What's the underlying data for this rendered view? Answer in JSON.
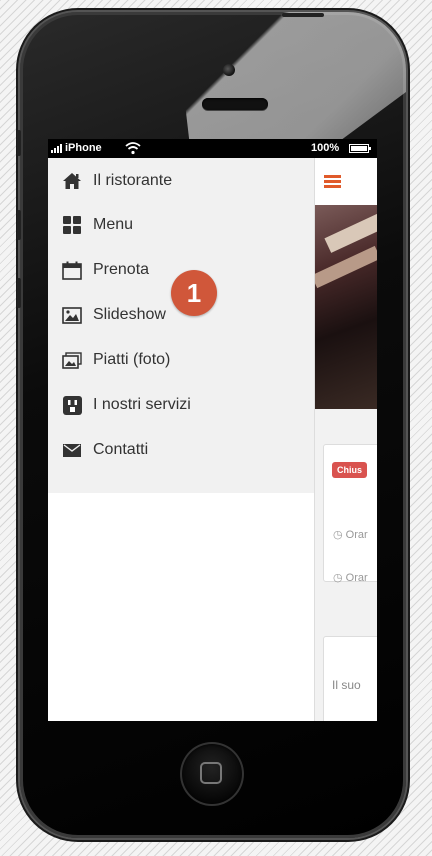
{
  "status_bar": {
    "carrier": "iPhone",
    "battery": "100%"
  },
  "menu": {
    "items": [
      {
        "label": "Il ristorante",
        "icon": "home-icon"
      },
      {
        "label": "Menu",
        "icon": "grid-icon"
      },
      {
        "label": "Prenota",
        "icon": "calendar-icon"
      },
      {
        "label": "Slideshow",
        "icon": "image-icon"
      },
      {
        "label": "Piatti (foto)",
        "icon": "photos-icon"
      },
      {
        "label": "I nostri servizi",
        "icon": "services-icon"
      },
      {
        "label": "Contatti",
        "icon": "envelope-icon"
      }
    ]
  },
  "content": {
    "badge": "Chius",
    "hours_1": "Orar",
    "hours_2": "Orar",
    "description": "Il suo"
  },
  "callout": {
    "number": "1"
  },
  "colors": {
    "accent": "#e05a2a",
    "callout": "#d0573a",
    "badge": "#d9534f"
  }
}
